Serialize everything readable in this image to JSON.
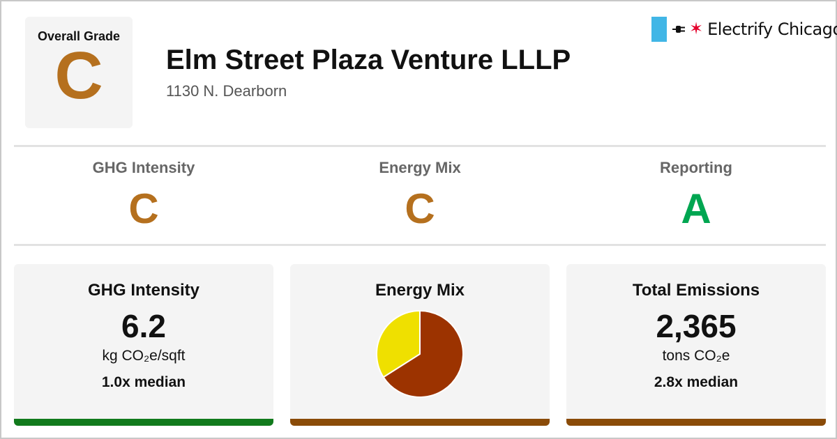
{
  "colors": {
    "grade_c": "#b5701e",
    "grade_a": "#00a651",
    "bar_green": "#117a1c",
    "bar_brown": "#8a4b08",
    "brand_blue": "#41b6e6",
    "brand_red": "#e4002b"
  },
  "overall": {
    "label": "Overall Grade",
    "grade": "C"
  },
  "building": {
    "name": "Elm Street Plaza Venture LLLP",
    "address": "1130 N. Dearborn"
  },
  "brand": {
    "name": "Electrify Chicago",
    "icons": [
      "plug-icon",
      "star-icon"
    ]
  },
  "grades": [
    {
      "label": "GHG Intensity",
      "grade": "C",
      "color": "#b5701e"
    },
    {
      "label": "Energy Mix",
      "grade": "C",
      "color": "#b5701e"
    },
    {
      "label": "Reporting",
      "grade": "A",
      "color": "#00a651"
    }
  ],
  "cards": {
    "ghg": {
      "title": "GHG Intensity",
      "value": "6.2",
      "unit": "kg CO₂e/sqft",
      "median": "1.0x median",
      "bar_color": "#117a1c"
    },
    "mix": {
      "title": "Energy Mix",
      "bar_color": "#8a4b08"
    },
    "emissions": {
      "title": "Total Emissions",
      "value": "2,365",
      "unit": "tons CO₂e",
      "median": "2.8x median",
      "bar_color": "#8a4b08"
    }
  },
  "chart_data": {
    "type": "pie",
    "values": [
      66,
      34
    ],
    "colors": [
      "#9c3300",
      "#efe000"
    ],
    "start_angle_deg": 0
  }
}
